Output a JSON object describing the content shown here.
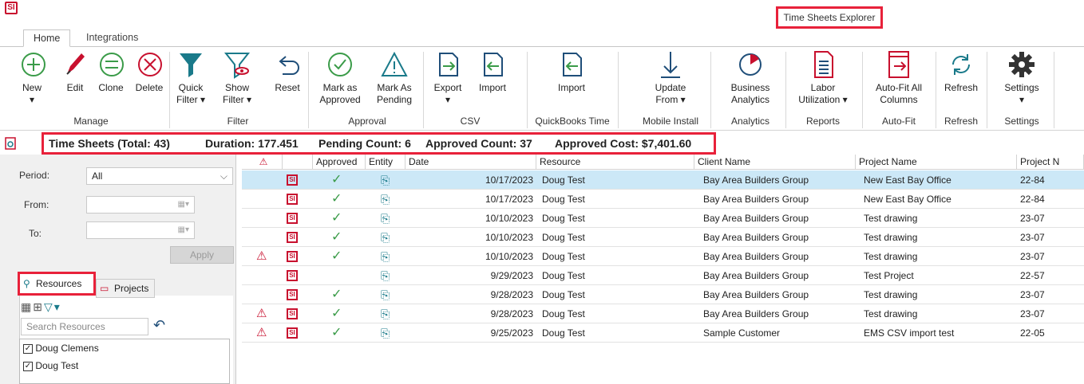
{
  "app": {
    "logo": "SI",
    "title": "Time Sheets Explorer"
  },
  "tabs": [
    "Home",
    "Integrations"
  ],
  "ribbon": {
    "buttons": {
      "new": "New",
      "edit": "Edit",
      "clone": "Clone",
      "delete": "Delete",
      "quick_filter": "Quick",
      "quick_filter2": "Filter ▾",
      "show_filter": "Show",
      "show_filter2": "Filter ▾",
      "reset": "Reset",
      "mark_approved": "Mark as",
      "mark_approved2": "Approved",
      "mark_pending": "Mark As",
      "mark_pending2": "Pending",
      "export": "Export",
      "import": "Import",
      "qb_import": "Import",
      "update": "Update",
      "update2": "From ▾",
      "business": "Business",
      "business2": "Analytics",
      "labor": "Labor",
      "labor2": "Utilization ▾",
      "autofit": "Auto-Fit All",
      "autofit2": "Columns",
      "refresh": "Refresh",
      "settings": "Settings"
    },
    "groups": {
      "manage": "Manage",
      "filter": "Filter",
      "approval": "Approval",
      "csv": "CSV",
      "quickbooks": "QuickBooks Time",
      "mobile": "Mobile Install",
      "analytics": "Analytics",
      "reports": "Reports",
      "autofit": "Auto-Fit",
      "refresh": "Refresh",
      "settings": "Settings"
    },
    "colors": {
      "green": "#3a9b48",
      "red": "#c8102e",
      "teal": "#1a7a8a",
      "navy": "#1f4e79",
      "accent_border": "#e8213a"
    }
  },
  "summary": {
    "title": "Time Sheets (Total: 43)",
    "duration": "Duration: 177.451",
    "pending": "Pending Count: 6",
    "approved": "Approved Count: 37",
    "cost": "Approved Cost: $7,401.60"
  },
  "filters": {
    "period_label": "Period:",
    "period_value": "All",
    "from_label": "From:",
    "to_label": "To:",
    "apply": "Apply"
  },
  "panel_tabs": {
    "resources": "Resources",
    "projects": "Projects"
  },
  "search": {
    "placeholder": "Search Resources"
  },
  "resources": [
    "Doug Clemens",
    "Doug Test"
  ],
  "grid": {
    "headers": {
      "approved": "Approved",
      "entity": "Entity",
      "date": "Date",
      "resource": "Resource",
      "client": "Client Name",
      "project": "Project Name",
      "project_no": "Project N"
    },
    "rows": [
      {
        "warn": false,
        "approved": true,
        "date": "10/17/2023",
        "resource": "Doug Test",
        "client": "Bay Area Builders Group",
        "project": "New East Bay Office",
        "pno": "22-84"
      },
      {
        "warn": false,
        "approved": true,
        "date": "10/17/2023",
        "resource": "Doug Test",
        "client": "Bay Area Builders Group",
        "project": "New East Bay Office",
        "pno": "22-84"
      },
      {
        "warn": false,
        "approved": true,
        "date": "10/10/2023",
        "resource": "Doug Test",
        "client": "Bay Area Builders Group",
        "project": "Test drawing",
        "pno": "23-07"
      },
      {
        "warn": false,
        "approved": true,
        "date": "10/10/2023",
        "resource": "Doug Test",
        "client": "Bay Area Builders Group",
        "project": "Test drawing",
        "pno": "23-07"
      },
      {
        "warn": true,
        "approved": true,
        "date": "10/10/2023",
        "resource": "Doug Test",
        "client": "Bay Area Builders Group",
        "project": "Test drawing",
        "pno": "23-07"
      },
      {
        "warn": false,
        "approved": false,
        "date": "9/29/2023",
        "resource": "Doug Test",
        "client": "Bay Area Builders Group",
        "project": "Test Project",
        "pno": "22-57"
      },
      {
        "warn": false,
        "approved": true,
        "date": "9/28/2023",
        "resource": "Doug Test",
        "client": "Bay Area Builders Group",
        "project": "Test drawing",
        "pno": "23-07"
      },
      {
        "warn": true,
        "approved": true,
        "date": "9/28/2023",
        "resource": "Doug Test",
        "client": "Bay Area Builders Group",
        "project": "Test drawing",
        "pno": "23-07"
      },
      {
        "warn": true,
        "approved": true,
        "date": "9/25/2023",
        "resource": "Doug Test",
        "client": "Sample Customer",
        "project": "EMS CSV import test",
        "pno": "22-05"
      }
    ]
  }
}
